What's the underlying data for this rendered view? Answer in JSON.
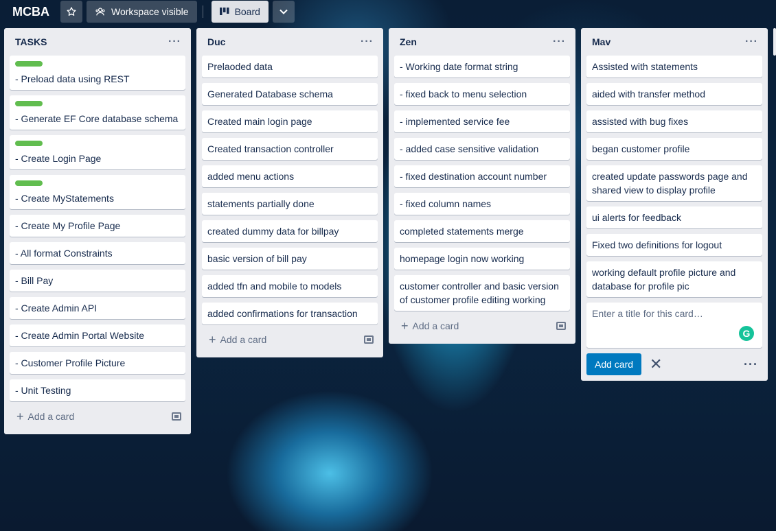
{
  "header": {
    "title": "MCBA",
    "visibility_label": "Workspace visible",
    "view_label": "Board"
  },
  "lists": [
    {
      "title": "TASKS",
      "cards": [
        {
          "text": "- Preload data using REST",
          "label_color": "#61bd4f"
        },
        {
          "text": "- Generate EF Core database schema",
          "label_color": "#61bd4f"
        },
        {
          "text": "- Create Login Page",
          "label_color": "#61bd4f"
        },
        {
          "text": "- Create MyStatements",
          "label_color": "#61bd4f"
        },
        {
          "text": "- Create My Profile Page"
        },
        {
          "text": "- All format Constraints"
        },
        {
          "text": "- Bill Pay"
        },
        {
          "text": "- Create Admin API"
        },
        {
          "text": "- Create Admin Portal Website"
        },
        {
          "text": "- Customer Profile Picture"
        },
        {
          "text": "- Unit Testing"
        }
      ],
      "add_label": "Add a card"
    },
    {
      "title": "Duc",
      "cards": [
        {
          "text": "Prelaoded data"
        },
        {
          "text": "Generated Database schema"
        },
        {
          "text": "Created main login page"
        },
        {
          "text": "Created transaction controller"
        },
        {
          "text": "added menu actions"
        },
        {
          "text": "statements partially done"
        },
        {
          "text": "created dummy data for billpay"
        },
        {
          "text": "basic version of bill pay"
        },
        {
          "text": "added tfn and mobile to models"
        },
        {
          "text": "added confirmations for transaction"
        }
      ],
      "add_label": "Add a card"
    },
    {
      "title": "Zen",
      "cards": [
        {
          "text": "- Working date format string"
        },
        {
          "text": "- fixed back to menu selection"
        },
        {
          "text": "- implemented service fee"
        },
        {
          "text": "- added case sensitive validation"
        },
        {
          "text": "- fixed destination account number"
        },
        {
          "text": "- fixed column names"
        },
        {
          "text": "completed statements merge"
        },
        {
          "text": "homepage login now working"
        },
        {
          "text": "customer controller and basic version of customer profile editing working"
        }
      ],
      "add_label": "Add a card"
    },
    {
      "title": "Mav",
      "cards": [
        {
          "text": "Assisted with statements"
        },
        {
          "text": "aided with transfer method"
        },
        {
          "text": "assisted with bug fixes"
        },
        {
          "text": "began customer profile"
        },
        {
          "text": "created update passwords page and shared view to display profile"
        },
        {
          "text": "ui alerts for feedback"
        },
        {
          "text": "Fixed two definitions for logout"
        },
        {
          "text": "working default profile picture and database for profile pic"
        }
      ],
      "composer": {
        "placeholder": "Enter a title for this card…",
        "add_button": "Add card"
      }
    }
  ],
  "icons": [
    "star-icon",
    "workspace-icon",
    "board-icon",
    "chevron-down-icon",
    "list-menu-icon",
    "plus-icon",
    "template-icon",
    "close-icon",
    "more-icon",
    "grammarly-icon"
  ],
  "colors": {
    "label_green": "#61bd4f",
    "primary_button": "#0079bf",
    "list_bg": "#ebecf0"
  }
}
